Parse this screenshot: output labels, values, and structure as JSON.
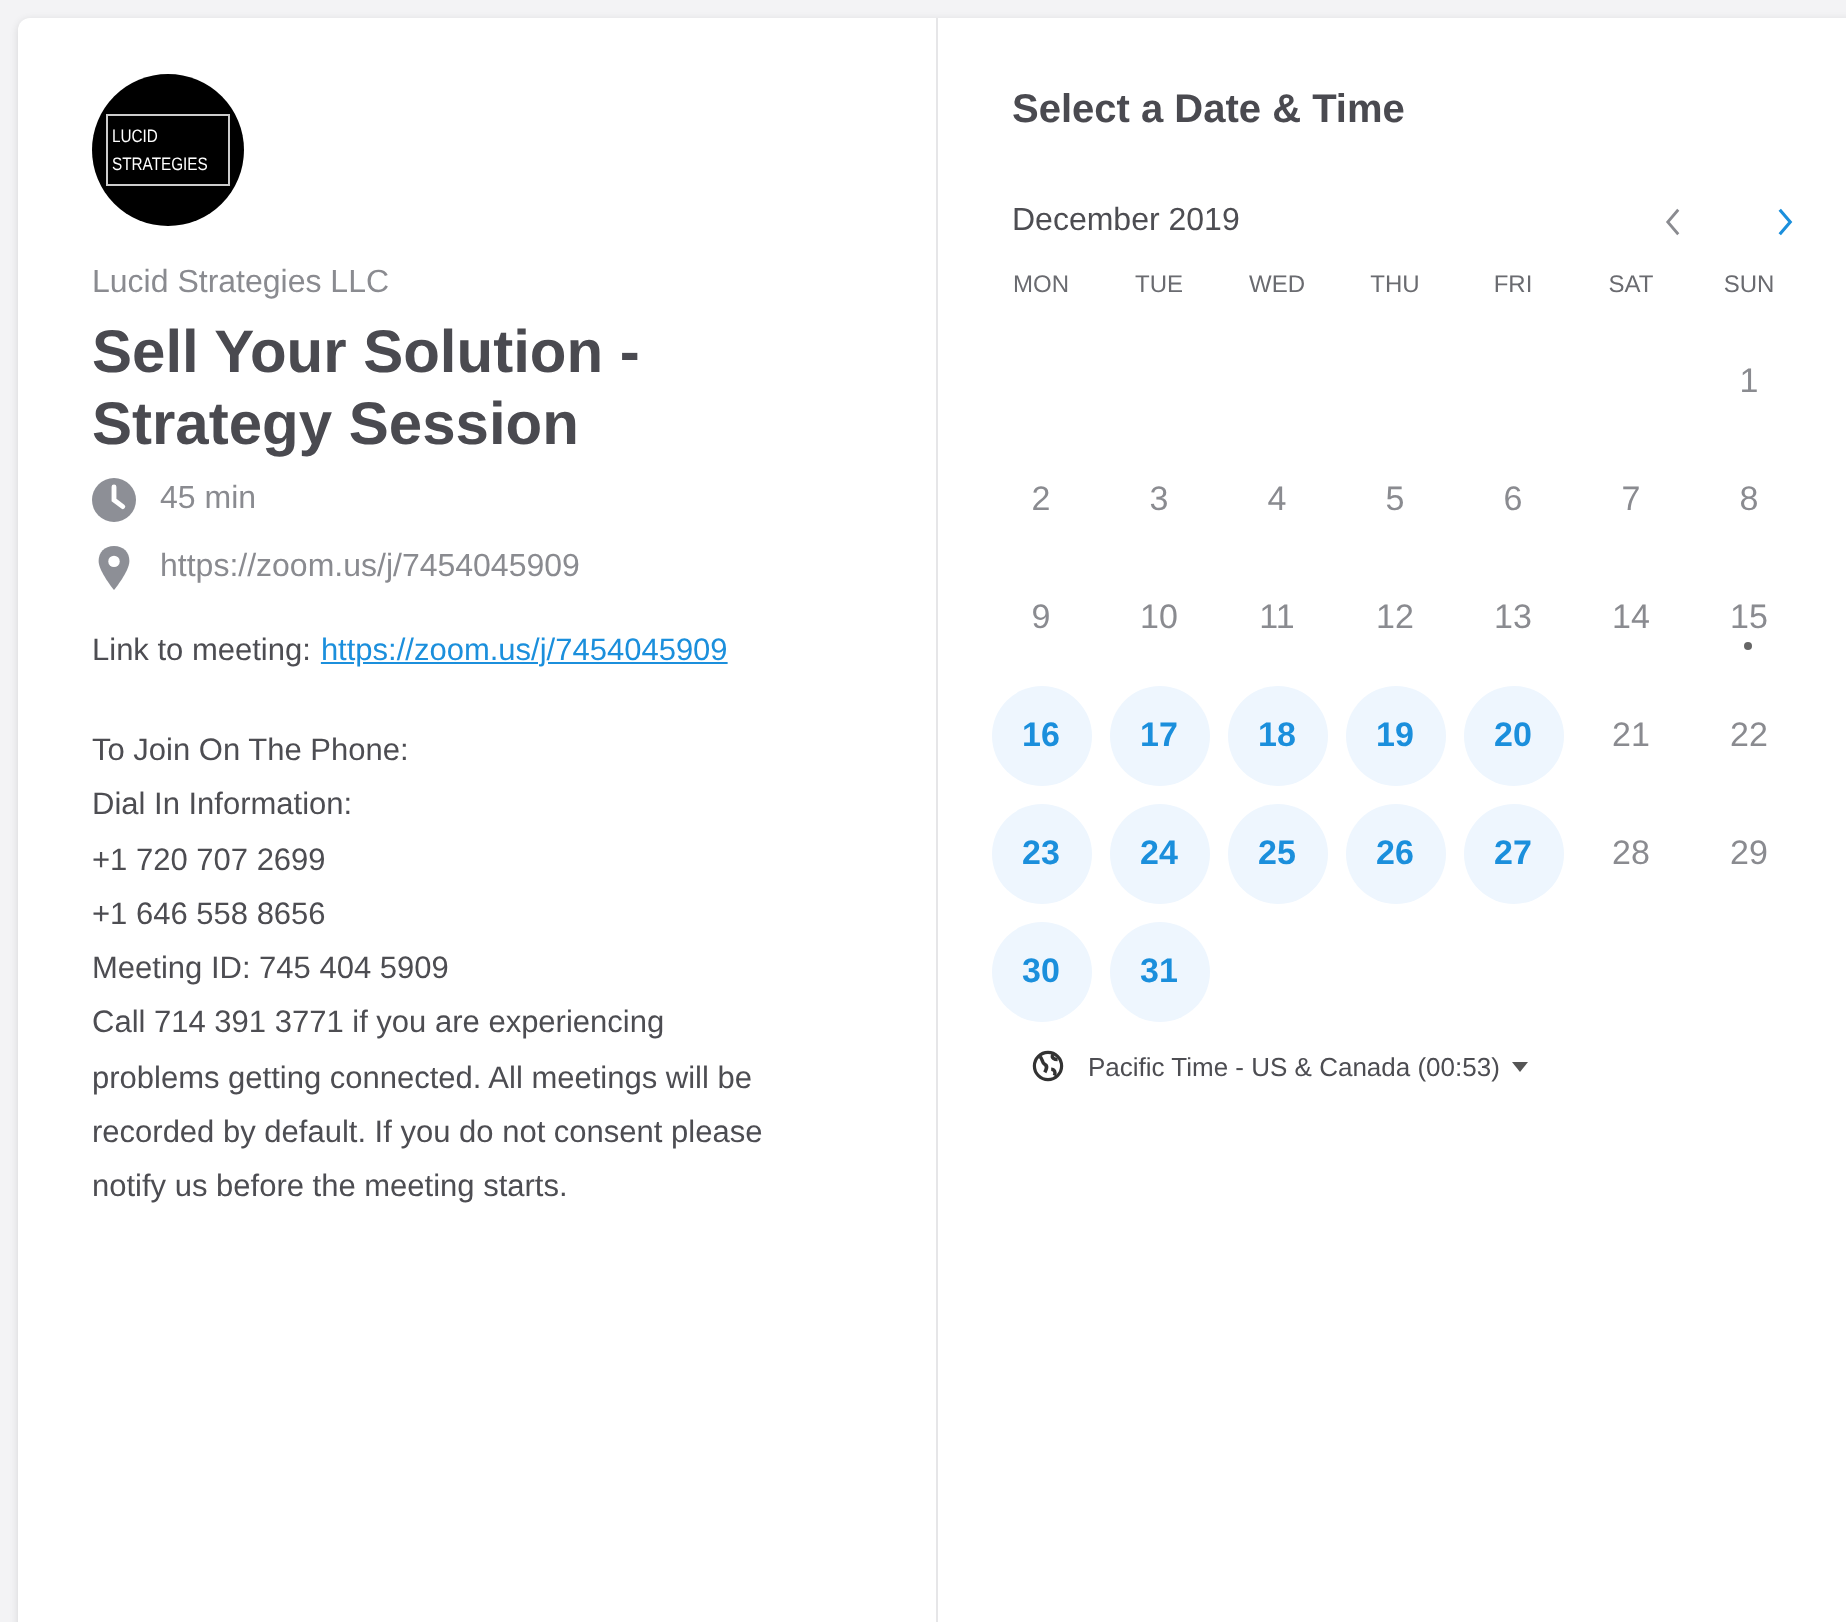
{
  "organizer": {
    "logo_lines": [
      "LUCID",
      "STRATEGIES"
    ],
    "name": "Lucid Strategies LLC"
  },
  "event": {
    "title": "Sell Your Solution - Strategy Session",
    "duration": "45 min",
    "location": "https://zoom.us/j/7454045909"
  },
  "description": {
    "link_label": "Link to meeting:",
    "link": "https://zoom.us/j/7454045909",
    "lines": [
      "To Join On The Phone:",
      "Dial In Information:",
      "+1 720 707 2699",
      "+1 646 558 8656",
      "Meeting ID: 745 404 5909",
      "Call 714 391 3771 if you are experiencing problems getting connected. All meetings will be recorded by default. If you do not consent please notify us before the meeting starts."
    ]
  },
  "calendar": {
    "title": "Select a Date & Time",
    "month": "December 2019",
    "prev": {
      "disabled": true
    },
    "next": {
      "disabled": false
    },
    "weekdays": [
      "MON",
      "TUE",
      "WED",
      "THU",
      "FRI",
      "SAT",
      "SUN"
    ],
    "weeks": [
      [
        {
          "kind": "blank"
        },
        {
          "kind": "blank"
        },
        {
          "kind": "blank"
        },
        {
          "kind": "blank"
        },
        {
          "kind": "blank"
        },
        {
          "kind": "blank"
        },
        {
          "kind": "day",
          "label": "1",
          "available": false,
          "today": false
        }
      ],
      [
        {
          "kind": "day",
          "label": "2",
          "available": false,
          "today": false
        },
        {
          "kind": "day",
          "label": "3",
          "available": false,
          "today": false
        },
        {
          "kind": "day",
          "label": "4",
          "available": false,
          "today": false
        },
        {
          "kind": "day",
          "label": "5",
          "available": false,
          "today": false
        },
        {
          "kind": "day",
          "label": "6",
          "available": false,
          "today": false
        },
        {
          "kind": "day",
          "label": "7",
          "available": false,
          "today": false
        },
        {
          "kind": "day",
          "label": "8",
          "available": false,
          "today": false
        }
      ],
      [
        {
          "kind": "day",
          "label": "9",
          "available": false,
          "today": false
        },
        {
          "kind": "day",
          "label": "10",
          "available": false,
          "today": false
        },
        {
          "kind": "day",
          "label": "11",
          "available": false,
          "today": false
        },
        {
          "kind": "day",
          "label": "12",
          "available": false,
          "today": false
        },
        {
          "kind": "day",
          "label": "13",
          "available": false,
          "today": false
        },
        {
          "kind": "day",
          "label": "14",
          "available": false,
          "today": false
        },
        {
          "kind": "day",
          "label": "15",
          "available": false,
          "today": true
        }
      ],
      [
        {
          "kind": "day",
          "label": "16",
          "available": true,
          "today": false
        },
        {
          "kind": "day",
          "label": "17",
          "available": true,
          "today": false
        },
        {
          "kind": "day",
          "label": "18",
          "available": true,
          "today": false
        },
        {
          "kind": "day",
          "label": "19",
          "available": true,
          "today": false
        },
        {
          "kind": "day",
          "label": "20",
          "available": true,
          "today": false
        },
        {
          "kind": "day",
          "label": "21",
          "available": false,
          "today": false
        },
        {
          "kind": "day",
          "label": "22",
          "available": false,
          "today": false
        }
      ],
      [
        {
          "kind": "day",
          "label": "23",
          "available": true,
          "today": false
        },
        {
          "kind": "day",
          "label": "24",
          "available": true,
          "today": false
        },
        {
          "kind": "day",
          "label": "25",
          "available": true,
          "today": false
        },
        {
          "kind": "day",
          "label": "26",
          "available": true,
          "today": false
        },
        {
          "kind": "day",
          "label": "27",
          "available": true,
          "today": false
        },
        {
          "kind": "day",
          "label": "28",
          "available": false,
          "today": false
        },
        {
          "kind": "day",
          "label": "29",
          "available": false,
          "today": false
        }
      ],
      [
        {
          "kind": "day",
          "label": "30",
          "available": true,
          "today": false
        },
        {
          "kind": "day",
          "label": "31",
          "available": true,
          "today": false
        }
      ]
    ],
    "timezone": "Pacific Time - US & Canada (00:53)"
  }
}
